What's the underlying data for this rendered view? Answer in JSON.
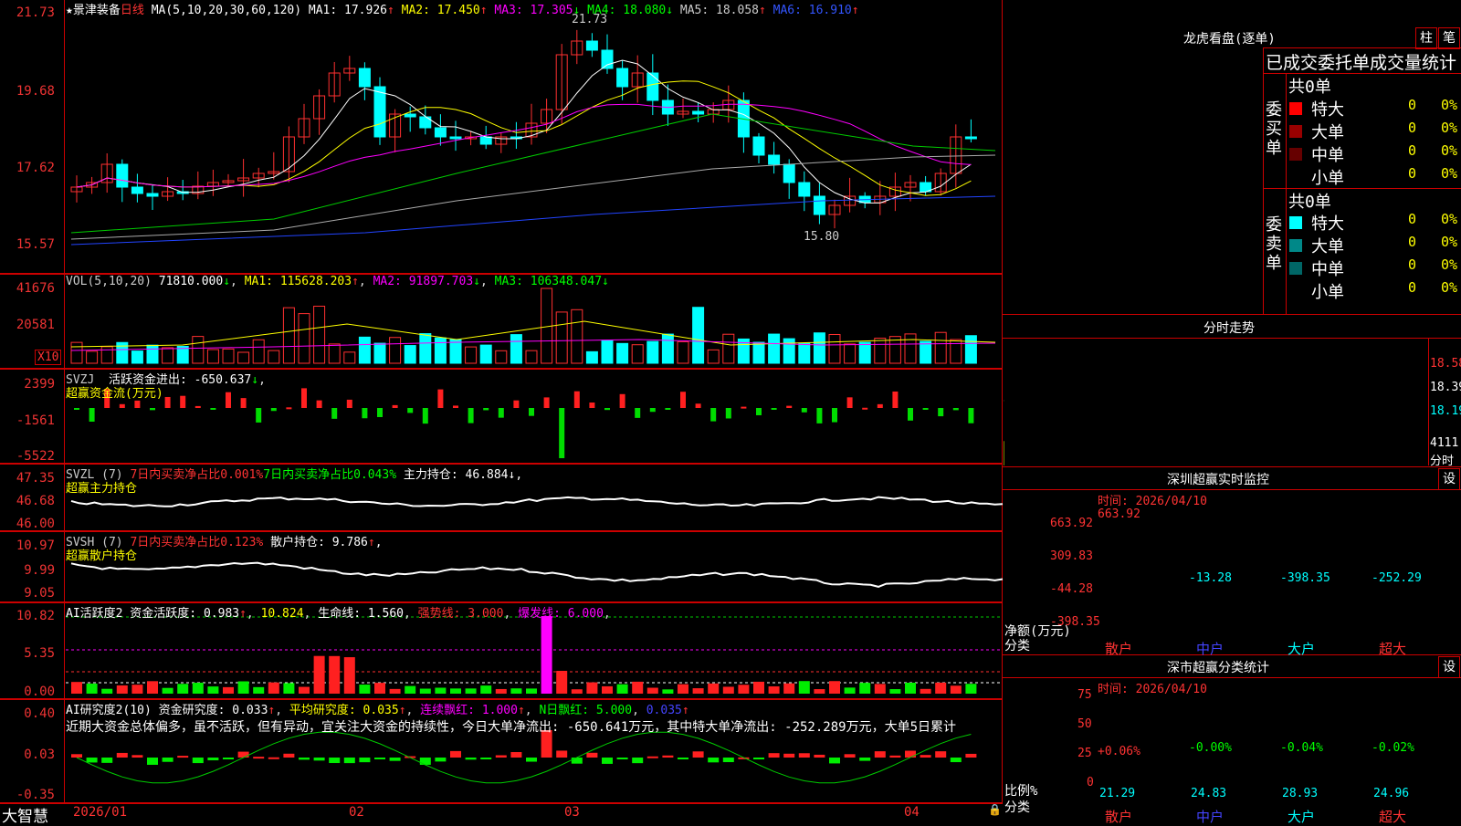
{
  "header": {
    "star": "★",
    "name": "景津装备",
    "period": "日线",
    "ma_prefix": "MA(5,10,20,30,60,120)",
    "ma": [
      {
        "label": "MA1: 17.926",
        "arrow": "↑",
        "color": "#ffffff"
      },
      {
        "label": "MA2: 17.450",
        "arrow": "↑",
        "color": "#ffff00"
      },
      {
        "label": "MA3: 17.305",
        "arrow": "↓",
        "color": "#ff00ff"
      },
      {
        "label": "MA4: 18.080",
        "arrow": "↓",
        "color": "#00ff00"
      },
      {
        "label": "MA5: 18.058",
        "arrow": "↑",
        "color": "#cccccc"
      },
      {
        "label": "MA6: 16.910",
        "arrow": "↑",
        "color": "#3355ff"
      }
    ]
  },
  "price_axis": [
    "21.73",
    "19.68",
    "17.62",
    "15.57"
  ],
  "annotations": {
    "high": "21.73",
    "low": "15.80"
  },
  "vol": {
    "title": "VOL(5,10,20)",
    "value": "71810.000",
    "ma1": "MA1: 115628.203",
    "ma2": "MA2: 91897.703",
    "ma3": "MA3: 106348.047",
    "axis": [
      "41676",
      "20581"
    ],
    "unit": "X10"
  },
  "svzj": {
    "title": "SVZJ",
    "label": "活跃资金进出: -650.637",
    "sub": "超赢资金流(万元)",
    "axis": [
      "2399",
      "-1561",
      "-5522"
    ]
  },
  "svzl": {
    "title": "SVZL (7)",
    "a": "7日内买卖净占比0.001%",
    "b": "7日内买卖净占比0.043%",
    "c": "主力持仓: 46.884",
    "sub": "超赢主力持仓",
    "axis": [
      "47.35",
      "46.68",
      "46.00"
    ]
  },
  "svsh": {
    "title": "SVSH (7)",
    "a": "7日内买卖净占比0.123%",
    "c": "散户持仓: 9.786",
    "sub": "超赢散户持仓",
    "axis": [
      "10.97",
      "9.99",
      "9.05"
    ]
  },
  "ai1": {
    "title": "AI活跃度2 资金活跃度: 0.983",
    "v2": "10.824",
    "life": "生命线: 1.560",
    "strong": "强势线: 3.000",
    "burst": "爆发线: 6.000",
    "axis": [
      "10.82",
      "5.35",
      "0.00"
    ]
  },
  "ai2": {
    "title": "AI研究度2(10) 资金研究度: 0.033",
    "avg": "平均研究度: 0.035",
    "streak": "连续飘红: 1.000",
    "nday": "N日飘红: 5.000",
    "last": "0.035",
    "comment": "近期大资金总体偏多，虽不活跃，但有异动，宜关注大资金的持续性，今日大单净流出: -650.641万元，其中特大单净流出: -252.289万元，大单5日累计",
    "axis": [
      "0.40",
      "0.03",
      "-0.35"
    ]
  },
  "dates": [
    "2026/01",
    "02",
    "03",
    "04"
  ],
  "brand": "大智慧",
  "dragon": {
    "title": "龙虎看盘(逐单)",
    "btn_a": "柱",
    "btn_b": "笔",
    "head": "已成交委托单成交量统计",
    "buy_label": "委买单",
    "sell_label": "委卖单",
    "buy_total": "共0单",
    "sell_total": "共0单",
    "buy_rows": [
      {
        "name": "特大",
        "n": "0",
        "p": "0%"
      },
      {
        "name": "大单",
        "n": "0",
        "p": "0%"
      },
      {
        "name": "中单",
        "n": "0",
        "p": "0%"
      },
      {
        "name": "小单",
        "n": "0",
        "p": "0%"
      }
    ],
    "sell_rows": [
      {
        "name": "特大",
        "n": "0",
        "p": "0%"
      },
      {
        "name": "大单",
        "n": "0",
        "p": "0%"
      },
      {
        "name": "中单",
        "n": "0",
        "p": "0%"
      },
      {
        "name": "小单",
        "n": "0",
        "p": "0%"
      }
    ]
  },
  "intraday": {
    "title": "分时走势",
    "axis": [
      "18.58",
      "18.39",
      "18.19"
    ],
    "vol": "4111",
    "vlabel": "分时"
  },
  "monitor": {
    "title": "深圳超赢实时监控",
    "settings": "设",
    "time": "时间: 2026/04/10",
    "axis": [
      "663.92",
      "309.83",
      "-44.28",
      "-398.35"
    ],
    "values": [
      "663.92",
      "-13.28",
      "-398.35",
      "-252.29"
    ],
    "cats": [
      "散户",
      "中户",
      "大户",
      "超大"
    ],
    "ylabel": "净额(万元)",
    "xlabel": "分类"
  },
  "classify": {
    "title": "深市超赢分类统计",
    "settings": "设",
    "time": "时间: 2026/04/10",
    "axis": [
      "75",
      "50",
      "25",
      "0"
    ],
    "pct": [
      "+0.06%",
      "-0.00%",
      "-0.04%",
      "-0.02%"
    ],
    "vals": [
      "21.29",
      "24.83",
      "28.93",
      "24.96"
    ],
    "cats": [
      "散户",
      "中户",
      "大户",
      "超大"
    ],
    "ylabel": "比例%",
    "xlabel": "分类"
  },
  "chart_data": {
    "type": "candlestick",
    "x": [
      "2026/01",
      "02",
      "03",
      "04"
    ],
    "ylim": [
      15.57,
      21.73
    ],
    "ma_lines": [
      "MA1",
      "MA2",
      "MA3",
      "MA4",
      "MA5",
      "MA6"
    ],
    "high": 21.73,
    "low": 15.8
  }
}
